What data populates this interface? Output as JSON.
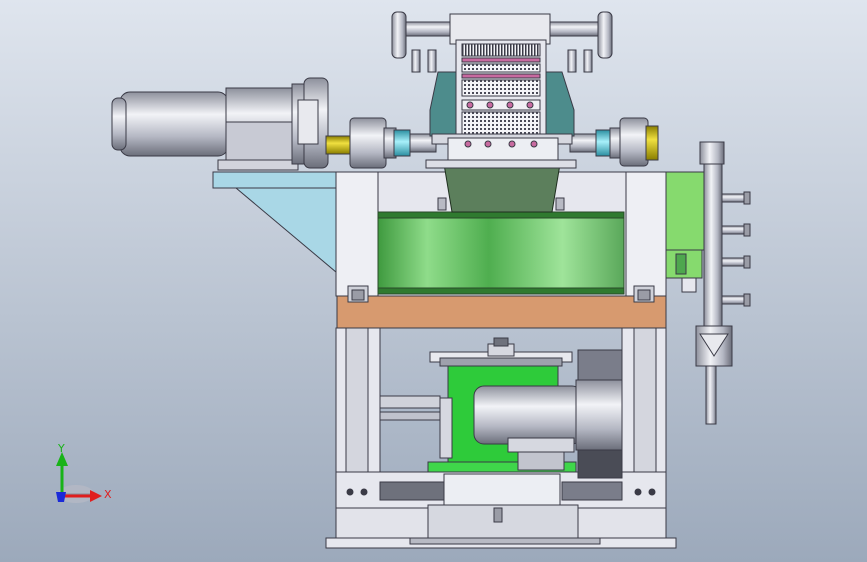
{
  "viewport": {
    "background_top": "#dfe5ee",
    "background_bottom": "#9ca9bb"
  },
  "colors": {
    "frame": "#e6e7ee",
    "frame_edge": "#3a3a46",
    "metal": "#b9bcc8",
    "metal_dark": "#7c7f8c",
    "drum_green": "#7fd07a",
    "hopper_green": "#5c7f5c",
    "motor_green": "#2ecb3a",
    "side_green": "#86da6e",
    "plate_orange": "#d79a6f",
    "wedge_blue": "#a9d7e6",
    "shaft_yellow": "#d6c400",
    "coupling_cyan": "#5ad7e6",
    "housing_teal": "#4d8c8c",
    "grille_pink": "#c86aa0"
  },
  "triad": {
    "y_label": "Y",
    "x_label": "X",
    "y_color": "#18b318",
    "x_color": "#e01e1e",
    "z_color": "#1a2ad8",
    "x_icon": "x-axis-arrow-icon",
    "y_icon": "y-axis-arrow-icon",
    "z_icon": "z-axis-arrow-icon"
  }
}
